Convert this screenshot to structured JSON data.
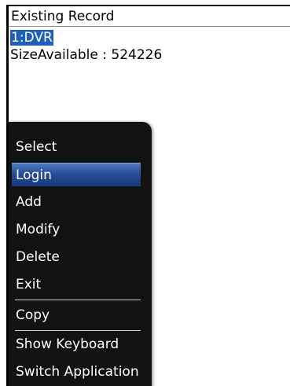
{
  "screen": {
    "title": "Existing Record",
    "records": [
      {
        "label": "1:DVR",
        "selected": true
      },
      {
        "label": "SizeAvailable : 524226",
        "selected": false
      }
    ]
  },
  "menu": {
    "items": [
      {
        "label": "Select"
      },
      {
        "label": "Login",
        "selected": true
      },
      {
        "label": "Add"
      },
      {
        "label": "Modify"
      },
      {
        "label": "Delete"
      },
      {
        "label": "Exit"
      },
      {
        "label": "Copy"
      },
      {
        "label": "Show Keyboard"
      },
      {
        "label": "Switch Application"
      }
    ]
  },
  "colors": {
    "selection": "#1e5fb8",
    "menu_background": "#121212"
  }
}
